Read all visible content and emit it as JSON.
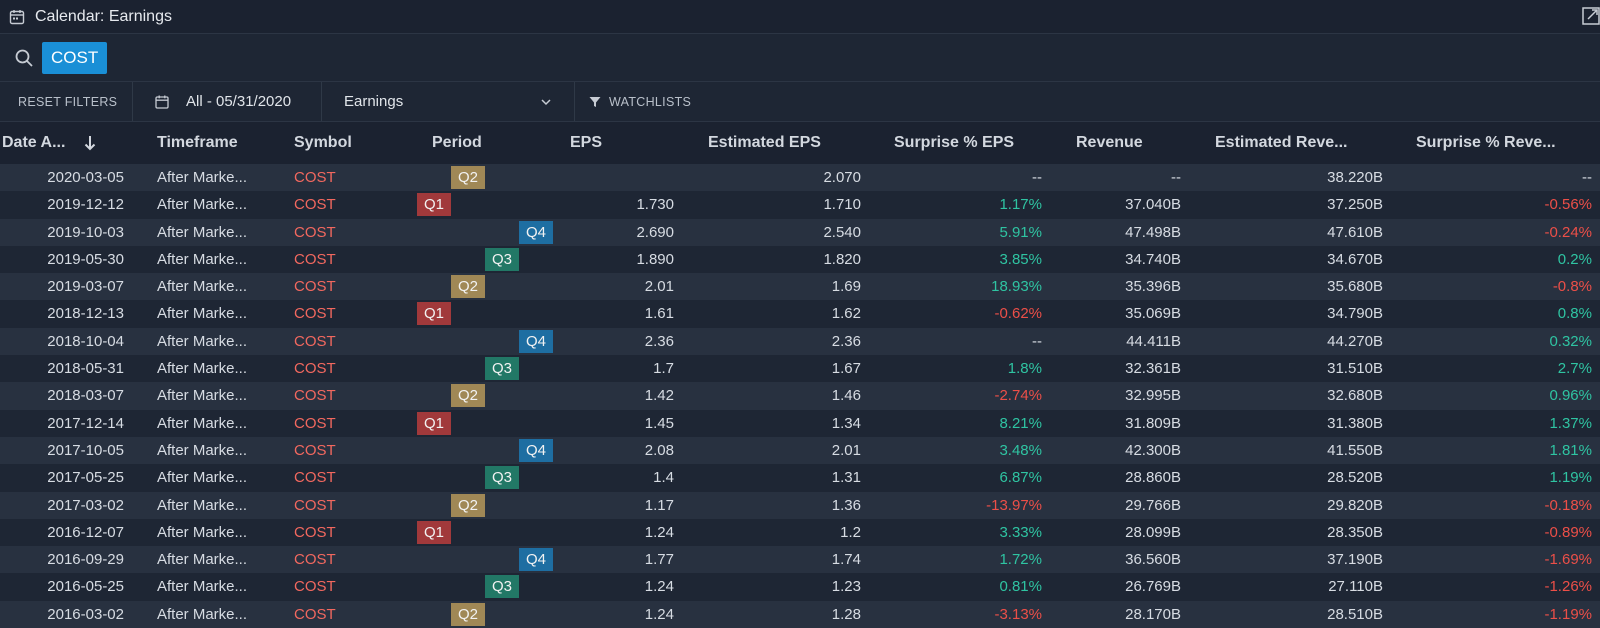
{
  "window": {
    "title": "Calendar: Earnings"
  },
  "search": {
    "chip": "COST"
  },
  "filters": {
    "reset_label": "RESET FILTERS",
    "date_range": "All - 05/31/2020",
    "event_type": "Earnings",
    "watchlists_label": "WATCHLISTS"
  },
  "table": {
    "headers": {
      "date": "Date A...",
      "timeframe": "Timeframe",
      "symbol": "Symbol",
      "period": "Period",
      "eps": "EPS",
      "est_eps": "Estimated EPS",
      "surprise_eps": "Surprise % EPS",
      "revenue": "Revenue",
      "est_revenue": "Estimated Reve...",
      "surprise_revenue": "Surprise % Reve..."
    },
    "sort": {
      "column": "date",
      "direction": "descending"
    },
    "rows": [
      {
        "date": "2020-03-05",
        "timeframe": "After Marke...",
        "symbol": "COST",
        "period": "Q2",
        "eps": "",
        "est_eps": "2.070",
        "surprise_eps": "--",
        "surprise_eps_dir": "neu",
        "revenue": "--",
        "est_revenue": "38.220B",
        "surprise_revenue": "--",
        "surprise_revenue_dir": "neu"
      },
      {
        "date": "2019-12-12",
        "timeframe": "After Marke...",
        "symbol": "COST",
        "period": "Q1",
        "eps": "1.730",
        "est_eps": "1.710",
        "surprise_eps": "1.17%",
        "surprise_eps_dir": "pos",
        "revenue": "37.040B",
        "est_revenue": "37.250B",
        "surprise_revenue": "-0.56%",
        "surprise_revenue_dir": "neg"
      },
      {
        "date": "2019-10-03",
        "timeframe": "After Marke...",
        "symbol": "COST",
        "period": "Q4",
        "eps": "2.690",
        "est_eps": "2.540",
        "surprise_eps": "5.91%",
        "surprise_eps_dir": "pos",
        "revenue": "47.498B",
        "est_revenue": "47.610B",
        "surprise_revenue": "-0.24%",
        "surprise_revenue_dir": "neg"
      },
      {
        "date": "2019-05-30",
        "timeframe": "After Marke...",
        "symbol": "COST",
        "period": "Q3",
        "eps": "1.890",
        "est_eps": "1.820",
        "surprise_eps": "3.85%",
        "surprise_eps_dir": "pos",
        "revenue": "34.740B",
        "est_revenue": "34.670B",
        "surprise_revenue": "0.2%",
        "surprise_revenue_dir": "pos"
      },
      {
        "date": "2019-03-07",
        "timeframe": "After Marke...",
        "symbol": "COST",
        "period": "Q2",
        "eps": "2.01",
        "est_eps": "1.69",
        "surprise_eps": "18.93%",
        "surprise_eps_dir": "pos",
        "revenue": "35.396B",
        "est_revenue": "35.680B",
        "surprise_revenue": "-0.8%",
        "surprise_revenue_dir": "neg"
      },
      {
        "date": "2018-12-13",
        "timeframe": "After Marke...",
        "symbol": "COST",
        "period": "Q1",
        "eps": "1.61",
        "est_eps": "1.62",
        "surprise_eps": "-0.62%",
        "surprise_eps_dir": "neg",
        "revenue": "35.069B",
        "est_revenue": "34.790B",
        "surprise_revenue": "0.8%",
        "surprise_revenue_dir": "pos"
      },
      {
        "date": "2018-10-04",
        "timeframe": "After Marke...",
        "symbol": "COST",
        "period": "Q4",
        "eps": "2.36",
        "est_eps": "2.36",
        "surprise_eps": "--",
        "surprise_eps_dir": "neu",
        "revenue": "44.411B",
        "est_revenue": "44.270B",
        "surprise_revenue": "0.32%",
        "surprise_revenue_dir": "pos"
      },
      {
        "date": "2018-05-31",
        "timeframe": "After Marke...",
        "symbol": "COST",
        "period": "Q3",
        "eps": "1.7",
        "est_eps": "1.67",
        "surprise_eps": "1.8%",
        "surprise_eps_dir": "pos",
        "revenue": "32.361B",
        "est_revenue": "31.510B",
        "surprise_revenue": "2.7%",
        "surprise_revenue_dir": "pos"
      },
      {
        "date": "2018-03-07",
        "timeframe": "After Marke...",
        "symbol": "COST",
        "period": "Q2",
        "eps": "1.42",
        "est_eps": "1.46",
        "surprise_eps": "-2.74%",
        "surprise_eps_dir": "neg",
        "revenue": "32.995B",
        "est_revenue": "32.680B",
        "surprise_revenue": "0.96%",
        "surprise_revenue_dir": "pos"
      },
      {
        "date": "2017-12-14",
        "timeframe": "After Marke...",
        "symbol": "COST",
        "period": "Q1",
        "eps": "1.45",
        "est_eps": "1.34",
        "surprise_eps": "8.21%",
        "surprise_eps_dir": "pos",
        "revenue": "31.809B",
        "est_revenue": "31.380B",
        "surprise_revenue": "1.37%",
        "surprise_revenue_dir": "pos"
      },
      {
        "date": "2017-10-05",
        "timeframe": "After Marke...",
        "symbol": "COST",
        "period": "Q4",
        "eps": "2.08",
        "est_eps": "2.01",
        "surprise_eps": "3.48%",
        "surprise_eps_dir": "pos",
        "revenue": "42.300B",
        "est_revenue": "41.550B",
        "surprise_revenue": "1.81%",
        "surprise_revenue_dir": "pos"
      },
      {
        "date": "2017-05-25",
        "timeframe": "After Marke...",
        "symbol": "COST",
        "period": "Q3",
        "eps": "1.4",
        "est_eps": "1.31",
        "surprise_eps": "6.87%",
        "surprise_eps_dir": "pos",
        "revenue": "28.860B",
        "est_revenue": "28.520B",
        "surprise_revenue": "1.19%",
        "surprise_revenue_dir": "pos"
      },
      {
        "date": "2017-03-02",
        "timeframe": "After Marke...",
        "symbol": "COST",
        "period": "Q2",
        "eps": "1.17",
        "est_eps": "1.36",
        "surprise_eps": "-13.97%",
        "surprise_eps_dir": "neg",
        "revenue": "29.766B",
        "est_revenue": "29.820B",
        "surprise_revenue": "-0.18%",
        "surprise_revenue_dir": "neg"
      },
      {
        "date": "2016-12-07",
        "timeframe": "After Marke...",
        "symbol": "COST",
        "period": "Q1",
        "eps": "1.24",
        "est_eps": "1.2",
        "surprise_eps": "3.33%",
        "surprise_eps_dir": "pos",
        "revenue": "28.099B",
        "est_revenue": "28.350B",
        "surprise_revenue": "-0.89%",
        "surprise_revenue_dir": "neg"
      },
      {
        "date": "2016-09-29",
        "timeframe": "After Marke...",
        "symbol": "COST",
        "period": "Q4",
        "eps": "1.77",
        "est_eps": "1.74",
        "surprise_eps": "1.72%",
        "surprise_eps_dir": "pos",
        "revenue": "36.560B",
        "est_revenue": "37.190B",
        "surprise_revenue": "-1.69%",
        "surprise_revenue_dir": "neg"
      },
      {
        "date": "2016-05-25",
        "timeframe": "After Marke...",
        "symbol": "COST",
        "period": "Q3",
        "eps": "1.24",
        "est_eps": "1.23",
        "surprise_eps": "0.81%",
        "surprise_eps_dir": "pos",
        "revenue": "26.769B",
        "est_revenue": "27.110B",
        "surprise_revenue": "-1.26%",
        "surprise_revenue_dir": "neg"
      },
      {
        "date": "2016-03-02",
        "timeframe": "After Marke...",
        "symbol": "COST",
        "period": "Q2",
        "eps": "1.24",
        "est_eps": "1.28",
        "surprise_eps": "-3.13%",
        "surprise_eps_dir": "neg",
        "revenue": "28.170B",
        "est_revenue": "28.510B",
        "surprise_revenue": "-1.19%",
        "surprise_revenue_dir": "neg"
      }
    ]
  },
  "colors": {
    "background": "#1b2230",
    "accent": "#1a8fd6",
    "positive": "#2fc4a2",
    "negative": "#ec4f48",
    "symbol": "#f2685f",
    "q1": "#a1393b",
    "q2": "#a08856",
    "q3": "#227866",
    "q4": "#1e6ea2"
  },
  "icons": [
    "calendar-icon",
    "popout-icon",
    "search-icon",
    "date-icon",
    "chevron-down-icon",
    "filter-icon",
    "sort-desc-icon"
  ]
}
